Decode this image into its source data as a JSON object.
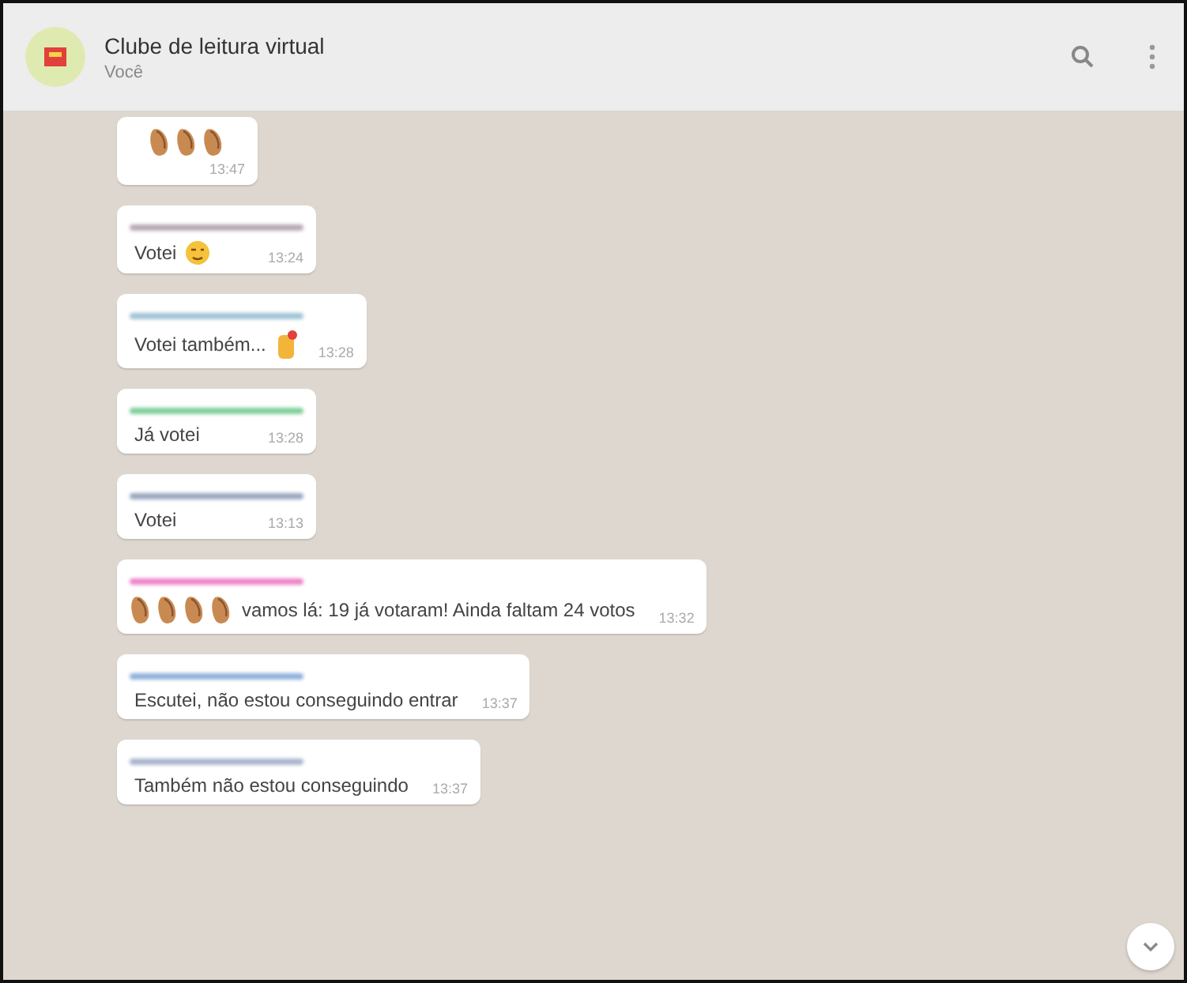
{
  "header": {
    "title": "Clube de leitura virtual",
    "subtitle": "Você"
  },
  "messages": [
    {
      "parts": [
        {
          "kind": "clap"
        },
        {
          "kind": "clap"
        },
        {
          "kind": "clap"
        }
      ],
      "time": "13:47"
    },
    {
      "sender": {
        "color": "#b8a9b5"
      },
      "parts": [
        {
          "kind": "text",
          "text": "Votei"
        },
        {
          "kind": "wink"
        }
      ],
      "time": "13:24"
    },
    {
      "sender": {
        "color": "#9fc3d6"
      },
      "parts": [
        {
          "kind": "text",
          "text": "Votei também..."
        },
        {
          "kind": "hands"
        }
      ],
      "time": "13:28"
    },
    {
      "sender": {
        "color": "#7fcf9a"
      },
      "parts": [
        {
          "kind": "text",
          "text": "Já votei"
        }
      ],
      "time": "13:28"
    },
    {
      "sender": {
        "color": "#9aa8c0"
      },
      "parts": [
        {
          "kind": "text",
          "text": "Votei"
        }
      ],
      "time": "13:13"
    },
    {
      "sender": {
        "color": "#ee82c8"
      },
      "parts": [
        {
          "kind": "clap"
        },
        {
          "kind": "clap"
        },
        {
          "kind": "clap"
        },
        {
          "kind": "clap"
        },
        {
          "kind": "text",
          "text": "vamos lá: 19 já votaram! Ainda faltam 24 votos"
        }
      ],
      "time": "13:32"
    },
    {
      "sender": {
        "color": "#8fb0dc"
      },
      "parts": [
        {
          "kind": "text",
          "text": "Escutei, não estou conseguindo entrar"
        }
      ],
      "time": "13:37"
    },
    {
      "sender": {
        "color": "#a8b4cc"
      },
      "parts": [
        {
          "kind": "text",
          "text": "Também não estou conseguindo"
        }
      ],
      "time": "13:37"
    }
  ]
}
